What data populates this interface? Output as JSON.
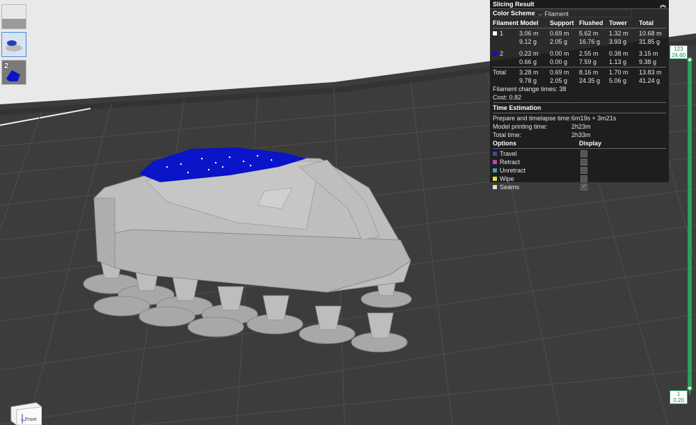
{
  "thumbnails": [
    {
      "label": ""
    },
    {
      "label": ""
    },
    {
      "label": "2"
    }
  ],
  "slicing_result": {
    "title": "Slicing Result",
    "color_scheme_label": "Color Scheme",
    "color_scheme_value": "Filament",
    "columns": [
      "Filament Model",
      "Support",
      "Flushed",
      "Tower",
      "Total"
    ],
    "filaments": [
      {
        "id": "1",
        "color": "#ffffff",
        "length": [
          "3.06 m",
          "0.69 m",
          "5.62 m",
          "1.32 m",
          "10.68 m"
        ],
        "weight": [
          "9.12 g",
          "2.05 g",
          "16.76 g",
          "3.93 g",
          "31.85 g"
        ]
      },
      {
        "id": "2",
        "color": "#0a14c8",
        "length": [
          "0.22 m",
          "0.00 m",
          "2.55 m",
          "0.38 m",
          "3.15 m"
        ],
        "weight": [
          "0.66 g",
          "0.00 g",
          "7.59 g",
          "1.13 g",
          "9.38 g"
        ]
      }
    ],
    "total": {
      "label": "Total",
      "length": [
        "3.28 m",
        "0.69 m",
        "8.16 m",
        "1.70 m",
        "13.83 m"
      ],
      "weight": [
        "9.78 g",
        "2.05 g",
        "24.35 g",
        "5.06 g",
        "41.24 g"
      ]
    },
    "filament_change": "Filament change times: 38",
    "cost": "Cost: 0.82",
    "time_estimation_title": "Time Estimation",
    "prepare_label": "Prepare and timelapse time:",
    "prepare_value": "6m19s + 3m21s",
    "model_time_label": "Model printing time:",
    "model_time_value": "2h23m",
    "total_time_label": "Total time:",
    "total_time_value": "2h33m",
    "options_label": "Options",
    "display_label": "Display",
    "options": [
      {
        "label": "Travel",
        "color": "#3050a0",
        "checked": false
      },
      {
        "label": "Retract",
        "color": "#c040c0",
        "checked": false
      },
      {
        "label": "Unretract",
        "color": "#40a0c0",
        "checked": false
      },
      {
        "label": "Wipe",
        "color": "#f0e020",
        "checked": false
      },
      {
        "label": "Seams",
        "color": "#e0e0e0",
        "checked": true
      }
    ]
  },
  "layer_slider": {
    "top_layer": "123",
    "top_height": "24.60",
    "bottom_layer": "1",
    "bottom_height": "0.20"
  },
  "nav_cube": {
    "face_label": "Front"
  },
  "colors": {
    "accent": "#2aa05a",
    "plate": "#3a3a3a",
    "model": "#b4b4b4",
    "filament2": "#0a14c8"
  }
}
